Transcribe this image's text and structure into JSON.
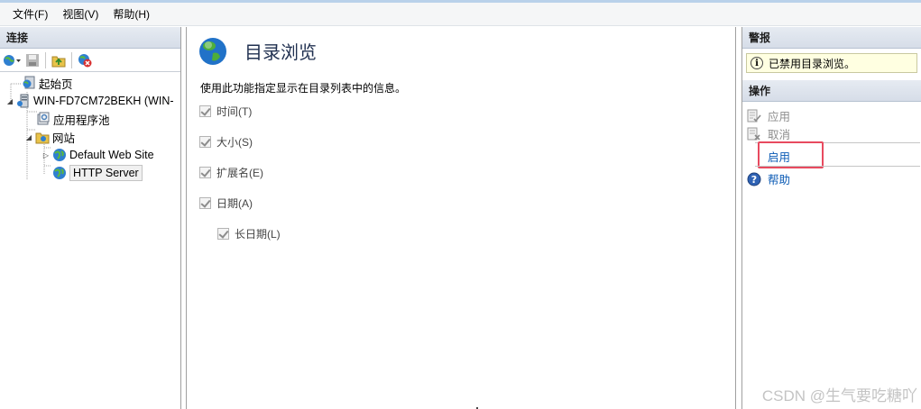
{
  "menubar": {
    "items": [
      "文件(F)",
      "视图(V)",
      "帮助(H)"
    ]
  },
  "connections": {
    "header": "连接",
    "toolbar_icons": [
      "globe-connect-icon",
      "save-icon",
      "folder-up-icon",
      "disconnect-icon"
    ],
    "tree": {
      "start_page": "起始页",
      "server": "WIN-FD7CM72BEKH (WIN-",
      "app_pools": "应用程序池",
      "sites": "网站",
      "site_default": "Default Web Site",
      "site_http": "HTTP Server"
    }
  },
  "main": {
    "title": "目录浏览",
    "description": "使用此功能指定显示在目录列表中的信息。",
    "options": [
      {
        "label": "时间(T)",
        "checked": true
      },
      {
        "label": "大小(S)",
        "checked": true
      },
      {
        "label": "扩展名(E)",
        "checked": true
      },
      {
        "label": "日期(A)",
        "checked": true
      },
      {
        "label": "长日期(L)",
        "checked": true
      }
    ]
  },
  "alerts": {
    "header": "警报",
    "message": "已禁用目录浏览。"
  },
  "actions": {
    "header": "操作",
    "apply": "应用",
    "cancel": "取消",
    "enable": "启用",
    "help": "帮助"
  },
  "watermark": "CSDN @生气要吃糖吖",
  "colors": {
    "link": "#0b5bb5",
    "highlight": "#e84a5f",
    "alert_bg": "#ffffe1"
  }
}
